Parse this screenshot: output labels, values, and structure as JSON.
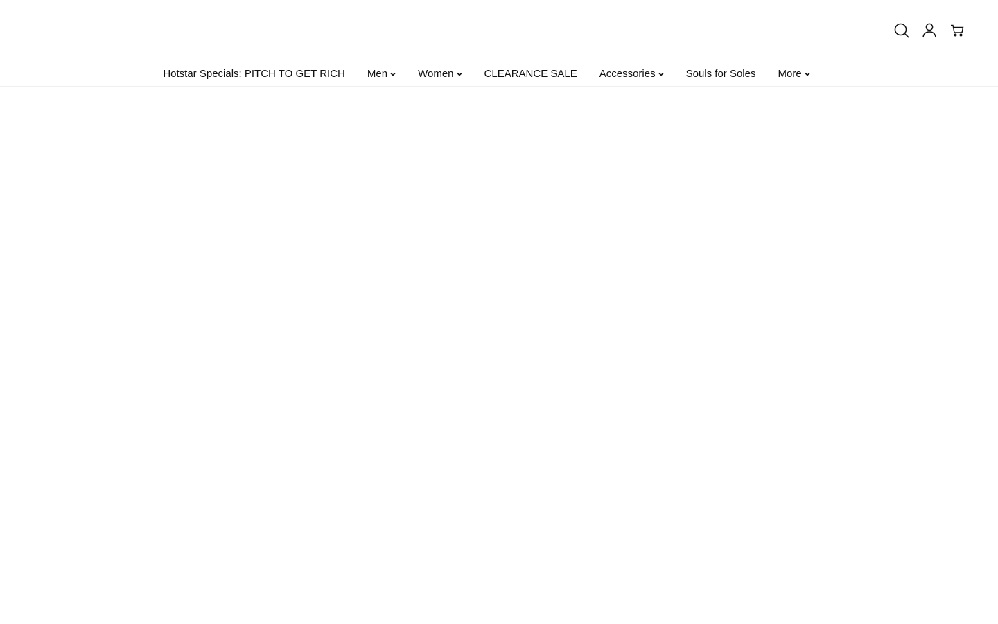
{
  "header": {
    "icons": {
      "search": "search-icon",
      "account": "account-icon",
      "cart": "cart-icon"
    }
  },
  "nav": {
    "items": [
      {
        "label": "Hotstar Specials: PITCH TO GET RICH",
        "has_dropdown": false
      },
      {
        "label": "Men",
        "has_dropdown": true
      },
      {
        "label": "Women",
        "has_dropdown": true
      },
      {
        "label": "CLEARANCE SALE",
        "has_dropdown": false
      },
      {
        "label": "Accessories",
        "has_dropdown": true
      },
      {
        "label": "Souls for Soles",
        "has_dropdown": false
      },
      {
        "label": "More",
        "has_dropdown": true
      }
    ]
  },
  "colors": {
    "text": "#111111",
    "header_border": "#8a8a8a",
    "background": "#ffffff"
  }
}
